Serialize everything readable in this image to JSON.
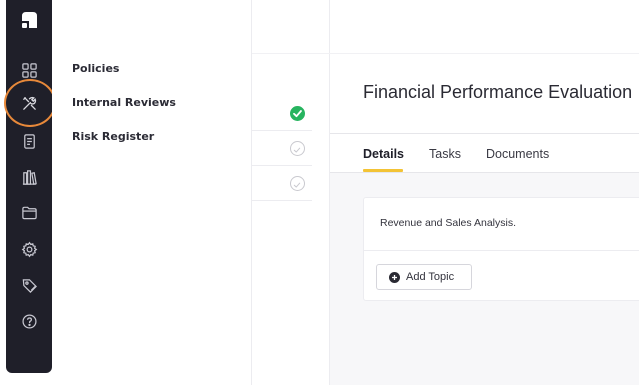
{
  "nav_rail": {
    "items": [
      {
        "icon": "logo-icon"
      },
      {
        "icon": "dashboard-grid-icon"
      },
      {
        "icon": "tools-icon",
        "highlighted": true
      },
      {
        "icon": "document-icon"
      },
      {
        "icon": "library-icon"
      },
      {
        "icon": "folder-icon"
      },
      {
        "icon": "gear-icon"
      },
      {
        "icon": "tag-icon"
      },
      {
        "icon": "help-icon"
      }
    ],
    "highlight_color": "#e8893a"
  },
  "flyout": {
    "items": [
      {
        "label": "Policies"
      },
      {
        "label": "Internal Reviews"
      },
      {
        "label": "Risk Register"
      }
    ]
  },
  "list_pane": {
    "rows": [
      {
        "status": "complete"
      },
      {
        "status": "incomplete"
      },
      {
        "status": "incomplete"
      }
    ]
  },
  "main": {
    "title": "Financial Performance Evaluation",
    "tabs": [
      {
        "label": "Details",
        "active": true
      },
      {
        "label": "Tasks",
        "active": false
      },
      {
        "label": "Documents",
        "active": false
      }
    ],
    "card": {
      "text": "Revenue and Sales Analysis.",
      "add_button_label": "Add Topic"
    }
  },
  "colors": {
    "rail_bg": "#1f1f29",
    "accent_tab": "#f3c335",
    "complete_green": "#27b45f"
  }
}
